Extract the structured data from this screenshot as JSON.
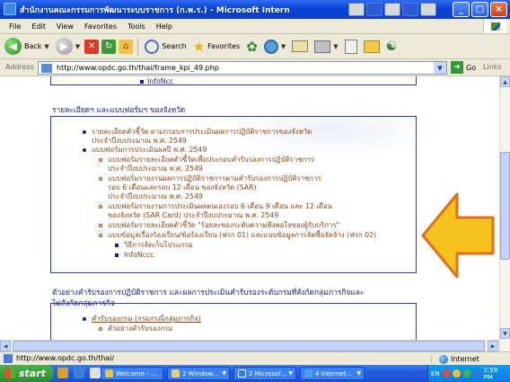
{
  "window": {
    "title": "สำนักงานคณะกรรมการพัฒนาระบบราชการ (ก.พ.ร.) - Microsoft Internet Explorer",
    "minimize": "_",
    "maximize": "□",
    "close": "×"
  },
  "menu": [
    "File",
    "Edit",
    "View",
    "Favorites",
    "Tools",
    "Help"
  ],
  "toolbar": {
    "back": "Back",
    "search": "Search",
    "favorites": "Favorites"
  },
  "address": {
    "label": "Address",
    "url": "http://www.opdc.go.th/thai/frame_kpi_49.php",
    "go": "Go",
    "links": "Links"
  },
  "content": {
    "top_item": "InfoNcc",
    "section1_heading": "รายละเอียดฯ และแบบฟอร์มฯ ของจังหวัด",
    "section1_items": [
      {
        "level": 1,
        "text": "รายละเอียดตัวชี้วัด ตามกรอบการประเมินผลการปฏิบัติราชการของจังหวัด"
      },
      {
        "level": 1,
        "text": "ประจำปีงบประมาณ พ.ศ. 2549",
        "cont": true
      },
      {
        "level": 1,
        "text": "แบบฟอร์มการประเมินผลปี พ.ศ. 2549"
      },
      {
        "level": 2,
        "text": "แบบฟอร์มรายละเอียดตัวชี้วัดเพื่อประกอบคำรับรองการปฏิบัติราชการ"
      },
      {
        "level": 2,
        "text": "ประจำปีงบประมาณ พ.ศ. 2549",
        "cont": true
      },
      {
        "level": 2,
        "text": "แบบฟอร์มรายงานผลการปฏิบัติราชการตามคำรับรองการปฏิบัติราชการ"
      },
      {
        "level": 2,
        "text": "รอบ 6 เดือนและรอบ 12 เดือน ของจังหวัด (SAR)",
        "cont": true
      },
      {
        "level": 2,
        "text": "ประจำปีงบประมาณ พ.ศ. 2549",
        "cont": true
      },
      {
        "level": 2,
        "text": "แบบฟอร์มรายงานการประเมินผลตนเองรอบ 6 เดือน 9 เดือน และ 12 เดือน"
      },
      {
        "level": 2,
        "text": "ของจังหวัด (SAR Card) ประจำปีงบประมาณ พ.ศ. 2549",
        "cont": true
      },
      {
        "level": 2,
        "text": "แบบฟอร์มรายละเอียดตัวชี้วัด \"ร้อยละของระดับความพึงพอใจของผู้รับบริการ\""
      },
      {
        "level": 2,
        "text": "แบบข้อมูลเรื่องร้องเรียน/ข้อร้องเรียน (ฟรก 01) และแบบข้อมูลการจัดซื้อจัดจ้าง (ฟรก 02)"
      },
      {
        "level": 3,
        "text": "วิธีการจัดเก็บโปรแกรม"
      },
      {
        "level": 3,
        "text": "InfoNccc"
      }
    ],
    "section2_heading_line1": "ตัวอย่างคำรับรองการปฏิบัติราชการ และผลการประเมินคำรับรองระดับกรมที่สังกัดกลุ่มภารกิจและ",
    "section2_heading_line2": "ไม่สังกัดกลุ่มภารกิจ",
    "section2_items": [
      {
        "level": 1,
        "text": "คำรับรองกรม (กรมกรณีกลุ่มภารกิจ)",
        "link": true
      },
      {
        "level": 2,
        "text": "ตัวอย่างคำรับรองกรม"
      }
    ]
  },
  "status": {
    "url": "http://www.opdc.go.th/thai/",
    "zone": "Internet"
  },
  "taskbar": {
    "start": "start",
    "tasks": [
      "Welcome - ...",
      "2 Window...",
      "2 Microsof...",
      "4 Internet..."
    ],
    "lang": "EN",
    "clock": "2:59 PM"
  },
  "colors": {
    "heading": "#1a237e",
    "sub_item": "#8b4513",
    "arrow_fill": "#f7c21f",
    "arrow_stroke": "#e0701a"
  }
}
